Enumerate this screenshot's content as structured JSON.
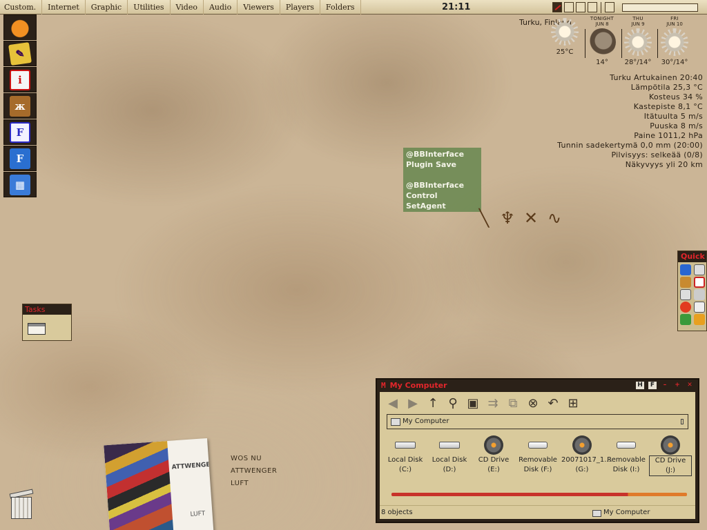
{
  "topbar": {
    "menus": [
      "Custom.",
      "Internet",
      "Graphic",
      "Utilities",
      "Video",
      "Audio",
      "Viewers",
      "Players",
      "Folders"
    ],
    "clock": "21:11"
  },
  "dock": {
    "apps": [
      "pumpkin-icon",
      "notepad-icon",
      "info-icon",
      "butterfly-icon",
      "fv-icon",
      "frontpage-icon",
      "grid-app-icon"
    ]
  },
  "weather": {
    "location": "Turku, Finland",
    "days": [
      {
        "line1": "",
        "line2": "",
        "icon": "sun-icon",
        "temp": "25°C"
      },
      {
        "line1": "TONIGHT",
        "line2": "JUN 8",
        "icon": "moon-icon",
        "temp": "14°"
      },
      {
        "line1": "THU",
        "line2": "JUN 9",
        "icon": "sun-icon",
        "temp": "28°/14°"
      },
      {
        "line1": "FRI",
        "line2": "JUN 10",
        "icon": "sun-icon",
        "temp": "30°/14°"
      }
    ],
    "stats": [
      "Turku Artukainen 20:40",
      "Lämpötila 25,3 °C",
      "Kosteus 34 %",
      "Kastepiste 8,1 °C",
      "Itätuulta 5 m/s",
      "Puuska 8 m/s",
      "Paine 1011,2 hPa",
      "Tunnin sadekertymä 0,0 mm (20:00)",
      "Pilvisyys: selkeää (0/8)",
      "Näkyvyys yli 20 km"
    ]
  },
  "popup": {
    "line1": "@BBInterface",
    "line2": "Plugin Save",
    "line3": "@BBInterface",
    "line4": "Control SetAgent"
  },
  "quick": {
    "title": "Quick"
  },
  "tasks": {
    "title": "Tasks"
  },
  "album": {
    "cover_title": "ATTWENGER",
    "cover_subtitle": "LUFT",
    "tracks": [
      "WOS NU",
      "ATTWENGER",
      "LUFT"
    ]
  },
  "window": {
    "title": "My Computer",
    "title_buttons": [
      "H",
      "F"
    ],
    "address": "My Computer",
    "drives": [
      {
        "icon": "hdd",
        "line1": "Local Disk",
        "line2": "(C:)"
      },
      {
        "icon": "hdd",
        "line1": "Local Disk",
        "line2": "(D:)"
      },
      {
        "icon": "cd",
        "line1": "CD Drive",
        "line2": "(E:)"
      },
      {
        "icon": "usb",
        "line1": "Removable",
        "line2": "Disk (F:)"
      },
      {
        "icon": "cd",
        "line1": "20071017_1...",
        "line2": "(G:)"
      },
      {
        "icon": "usb",
        "line1": "Removable",
        "line2": "Disk (I:)"
      },
      {
        "icon": "cd",
        "line1": "CD Drive",
        "line2": "(J:)"
      }
    ],
    "status_left": "8 objects",
    "status_right": "My Computer"
  },
  "colors": {
    "accent_red": "#e2262b",
    "panel_dark": "#2b2118",
    "panel_tan": "#d9ca9c"
  }
}
